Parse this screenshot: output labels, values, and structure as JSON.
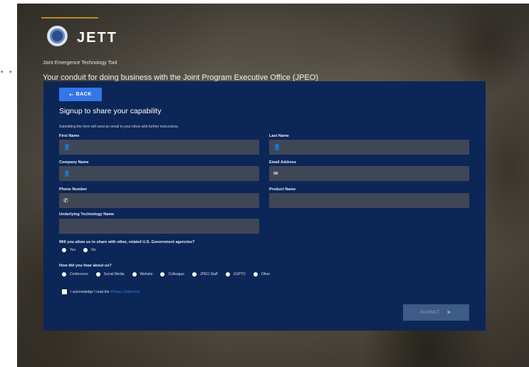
{
  "side": {
    "dots": "• •"
  },
  "header": {
    "logo_text": "JETT",
    "tool_name": "Joint Emergence Technology Tool",
    "tagline": "Your conduit for doing business with the Joint Program Executive Office (JPEO)"
  },
  "form": {
    "back_label": "BACK",
    "back_icon": "arrow-left-icon",
    "title": "Signup to share your capability",
    "note": "Submitting the form will send an email to your inbox with further instructions.",
    "fields": {
      "first_name": {
        "label": "First Name",
        "value": "",
        "icon": "👤"
      },
      "last_name": {
        "label": "Last Name",
        "value": "",
        "icon": "👤"
      },
      "company_name": {
        "label": "Company Name",
        "value": "",
        "icon": "👤"
      },
      "email": {
        "label": "Email Address",
        "value": "",
        "icon": "✉"
      },
      "phone": {
        "label": "Phone Number",
        "value": "",
        "icon": "✆"
      },
      "product": {
        "label": "Product Name",
        "value": ""
      },
      "technology": {
        "label": "Underlying Technology Name",
        "value": ""
      }
    },
    "share_question": "Will you allow us to share with other, related U.S. Government agencies?",
    "share_options": [
      "Yes",
      "No"
    ],
    "hear_question": "How did you hear about us?",
    "hear_options": [
      "Conference",
      "Social Media",
      "Website",
      "Colleague",
      "JPEO Staff",
      "USPTO",
      "Other"
    ],
    "ack_text": "I acknowledge I read the",
    "ack_link": "Privacy Statement",
    "submit_label": "SUBMIT",
    "submit_icon": "send-icon"
  },
  "colors": {
    "panel": "#0c2657",
    "field": "#3f4757",
    "back_button": "#3576e8",
    "submit_disabled": "#3e5a86",
    "link": "#3b7ad9",
    "accent_line": "#b38f2a"
  }
}
